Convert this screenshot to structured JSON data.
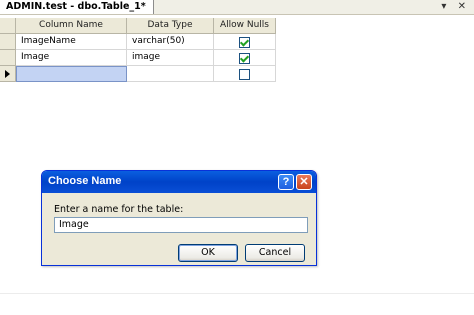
{
  "tab": {
    "title": "ADMIN.test - dbo.Table_1*",
    "pin_glyph": "▾",
    "close_glyph": "✕"
  },
  "grid": {
    "columns": [
      "Column Name",
      "Data Type",
      "Allow Nulls"
    ],
    "rows": [
      {
        "name": "ImageName",
        "type": "varchar(50)",
        "allow_nulls": true
      },
      {
        "name": "Image",
        "type": "image",
        "allow_nulls": true
      },
      {
        "name": "",
        "type": "",
        "allow_nulls": false
      }
    ]
  },
  "dialog": {
    "title": "Choose Name",
    "help_glyph": "?",
    "close_glyph": "✕",
    "prompt": "Enter a name for the table:",
    "value": "Image",
    "ok_label": "OK",
    "cancel_label": "Cancel"
  }
}
